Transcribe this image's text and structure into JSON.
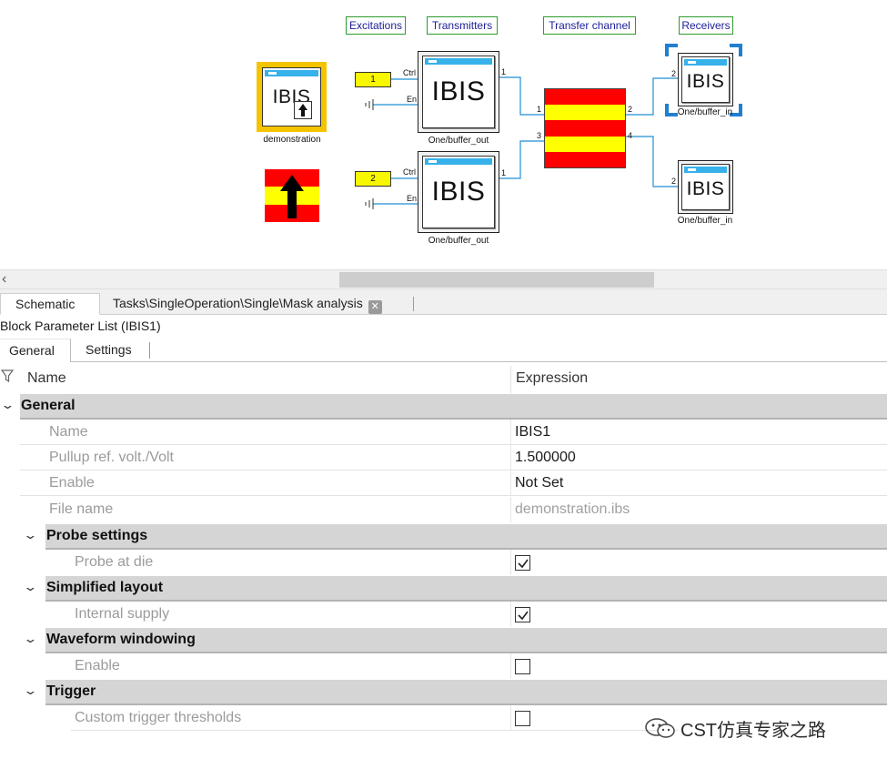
{
  "schematic": {
    "group_labels": {
      "excitations": "Excitations",
      "transmitters": "Transmitters",
      "transfer_channel": "Transfer channel",
      "receivers": "Receivers"
    },
    "demo_block": {
      "icon_text": "IBIS",
      "caption": "demonstration",
      "border_color": "#f2c500"
    },
    "excitation_1": "1",
    "excitation_2": "2",
    "transmitter_1": {
      "icon_text": "IBIS",
      "caption": "One/buffer_out",
      "port_ctrl": "Ctrl",
      "port_en": "En",
      "port_out": "1"
    },
    "transmitter_2": {
      "icon_text": "IBIS",
      "caption": "One/buffer_out",
      "port_ctrl": "Ctrl",
      "port_en": "En",
      "port_out": "1"
    },
    "channel": {
      "ports": [
        "1",
        "2",
        "3",
        "4"
      ],
      "stripe_colors": [
        "#ff0000",
        "#ffff00"
      ]
    },
    "receiver_1": {
      "icon_text": "IBIS",
      "caption": "One/buffer_in",
      "port": "2",
      "selected": true
    },
    "receiver_2": {
      "icon_text": "IBIS",
      "caption": "One/buffer_in",
      "port": "2"
    },
    "wire_color": "#1e8fd4"
  },
  "doc_tabs": [
    {
      "label": "Schematic",
      "active": true
    },
    {
      "label": "Tasks\\SingleOperation\\Single\\Mask analysis",
      "active": false,
      "closable": true
    }
  ],
  "panel": {
    "title": "Block Parameter List (IBIS1)",
    "tabs": [
      {
        "label": "General",
        "active": true
      },
      {
        "label": "Settings",
        "active": false
      }
    ],
    "columns": {
      "name": "Name",
      "expression": "Expression"
    }
  },
  "grid": {
    "general": {
      "label": "General",
      "rows": [
        {
          "name": "Name",
          "value": "IBIS1"
        },
        {
          "name": "Pullup ref. volt./Volt",
          "value": "1.500000"
        },
        {
          "name": "Enable",
          "value": "Not Set"
        },
        {
          "name": "File name",
          "value": "demonstration.ibs"
        }
      ]
    },
    "probe_settings": {
      "label": "Probe settings",
      "row": {
        "name": "Probe at die",
        "checked": true
      }
    },
    "simplified_layout": {
      "label": "Simplified layout",
      "row": {
        "name": "Internal supply",
        "checked": true
      }
    },
    "waveform_windowing": {
      "label": "Waveform windowing",
      "row": {
        "name": "Enable",
        "checked": false
      }
    },
    "trigger": {
      "label": "Trigger",
      "row": {
        "name": "Custom trigger thresholds",
        "checked": false
      }
    }
  },
  "watermark": "CST仿真专家之路"
}
